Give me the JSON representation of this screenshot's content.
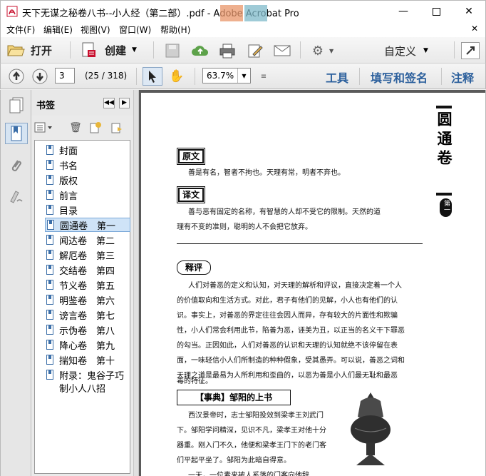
{
  "window": {
    "title": "天下无谋之秘卷八书--小人经（第二部）.pdf - Adobe Acrobat Pro"
  },
  "menu": [
    "文件(F)",
    "编辑(E)",
    "视图(V)",
    "窗口(W)",
    "帮助(H)"
  ],
  "toolbar": {
    "open": "打开",
    "create": "创建",
    "customize": "自定义"
  },
  "nav": {
    "page_value": "3",
    "page_count": "(25 / 318)",
    "zoom": "63.7%"
  },
  "tasks": {
    "tools": "工具",
    "fill_sign": "填写和签名",
    "comment": "注释"
  },
  "bookmarks": {
    "title": "书签",
    "items": [
      "封面",
      "书名",
      "版权",
      "前言",
      "目录",
      "圆通卷　第一",
      "闻达卷　第二",
      "解厄卷　第三",
      "交结卷　第四",
      "节义卷　第五",
      "明鉴卷　第六",
      "谤言卷　第七",
      "示伪卷　第八",
      "降心卷　第九",
      "揣知卷　第十",
      "附录：鬼谷子巧",
      "制小人八招"
    ],
    "selected_index": 5
  },
  "page": {
    "side_title": "圆通卷",
    "side_badge": "第一",
    "yuanwen": "原文",
    "yuanwen_text": "善是有名，智者不拘也。天理有常，明者不弃也。",
    "yiwen": "译文",
    "yiwen_lines": [
      "善与恶有固定的名称，有智慧的人却不受它的限制。天然的道",
      "理有不变的准则，聪明的人不会把它放弃。"
    ],
    "shiping": "释评",
    "shiping_lines": [
      "人们对善恶的定义和认知，对天理的解析和评议，直接决定着一个人",
      "的价值取向和生活方式。对此，君子有他们的见解，小人也有他们的认",
      "识。事实上，对善恶的界定往往会因人而异，存有较大的片面性和欺骗",
      "性，小人们常会利用此节，陷善为恶，诬美为丑，以正当的名义干下罪恶",
      "的勾当。正因如此，人们对善恶的认识和天理的认知就绝不该停留在表",
      "面，一味轻信小人们所制造的种种假象，受其愚弄。可以说，善恶之词和",
      "天理之道是最易为人所利用和歪曲的，以恶为善是小人们最无耻和最恶",
      "毒的特征。"
    ],
    "shidian": "【事典】邹阳的上书",
    "shidian_lines": [
      "西汉景帝时，志士邹阳投效到梁孝王刘武门",
      "下。邹阳学问精深，见识不凡，梁孝王对他十分",
      "器重。刚入门不久，他便和梁孝王门下的老门客",
      "们平起平坐了。邹阳为此暗自得意。",
      "一天，一位素来被人奚落的门客向他辞"
    ]
  }
}
